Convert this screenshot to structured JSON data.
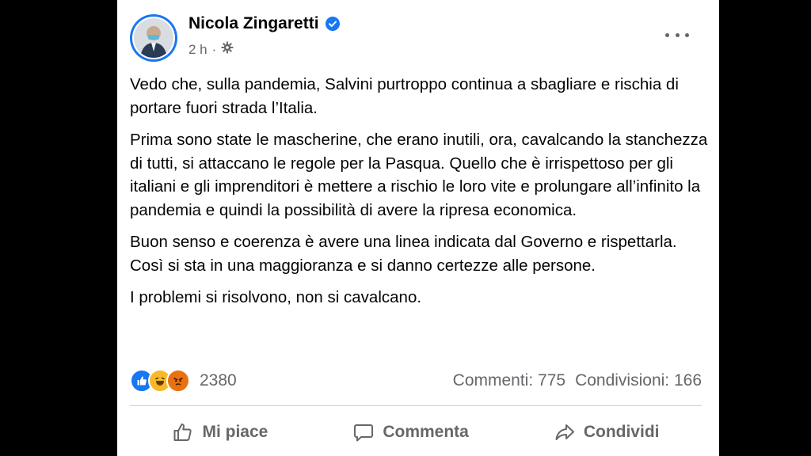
{
  "post": {
    "author": "Nicola Zingaretti",
    "time": "2 h",
    "paragraphs": [
      "Vedo che, sulla pandemia, Salvini purtroppo continua a sbagliare e rischia di portare fuori strada l’Italia.",
      "Prima sono state le mascherine, che erano inutili, ora, cavalcando la stanchezza di tutti, si attaccano le regole per la Pasqua. Quello che è irrispettoso per gli italiani e gli imprenditori è mettere a rischio le loro vite e prolungare all’infinito la pandemia e quindi la possibilità di avere la ripresa economica.",
      "Buon senso e coerenza è avere una linea indicata dal Governo e rispettarla. Così si sta in una maggioranza e si danno certezze alle persone.",
      "I problemi si risolvono, non si cavalcano."
    ]
  },
  "stats": {
    "reactions_count": "2380",
    "reaction_icons": [
      "like-icon",
      "haha-icon",
      "angry-icon"
    ],
    "comments": "Commenti: 775",
    "shares": "Condivisioni: 166"
  },
  "actions": {
    "like": "Mi piace",
    "comment": "Commenta",
    "share": "Condividi"
  },
  "colors": {
    "brand": "#1877f2",
    "text": "#050505",
    "secondary": "#65676b"
  }
}
